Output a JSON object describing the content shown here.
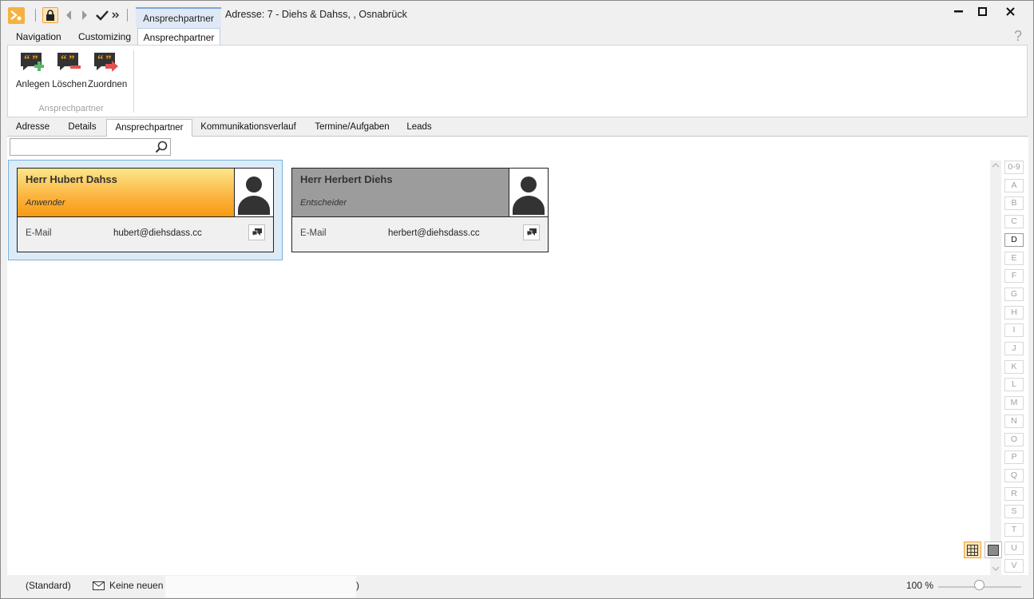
{
  "window": {
    "quick_tab_label": "Ansprechpartner",
    "title": "Adresse: 7 - Diehs & Dahss, , Osnabrück",
    "controls": {
      "minimize": "▬",
      "maximize": "☐",
      "close": "✕"
    }
  },
  "ribbon": {
    "tabs": [
      {
        "label": "Navigation"
      },
      {
        "label": "Customizing"
      },
      {
        "label": "Ansprechpartner",
        "active": true
      }
    ],
    "help": "?",
    "group_label": "Ansprechpartner",
    "buttons": [
      {
        "label": "Anlegen",
        "icon": "quote-add-icon"
      },
      {
        "label": "Löschen",
        "icon": "quote-delete-icon"
      },
      {
        "label": "Zuordnen",
        "icon": "quote-assign-icon"
      }
    ]
  },
  "content_tabs": [
    {
      "label": "Adresse"
    },
    {
      "label": "Details"
    },
    {
      "label": "Ansprechpartner",
      "active": true
    },
    {
      "label": "Kommunikationsverlauf"
    },
    {
      "label": "Termine/Aufgaben"
    },
    {
      "label": "Leads"
    }
  ],
  "search": {
    "value": "",
    "placeholder": ""
  },
  "contacts": [
    {
      "name": "Herr Hubert Dahss",
      "role": "Anwender",
      "field_label": "E-Mail",
      "field_value": "hubert@diehsdass.cc",
      "selected": true
    },
    {
      "name": "Herr Herbert Diehs",
      "role": "Entscheider",
      "field_label": "E-Mail",
      "field_value": "herbert@diehsdass.cc",
      "selected": false
    }
  ],
  "alphabet": [
    "0-9",
    "A",
    "B",
    "C",
    "D",
    "E",
    "F",
    "G",
    "H",
    "I",
    "J",
    "K",
    "L",
    "M",
    "N",
    "O",
    "P",
    "Q",
    "R",
    "S",
    "T",
    "U",
    "V"
  ],
  "alphabet_active": "D",
  "statusbar": {
    "profile": "(Standard)",
    "messages": "Keine neuen",
    "tail": ")",
    "zoom": "100 %",
    "zoom_level": 0.5
  },
  "colors": {
    "selected_card": "#fbb33d",
    "unselected_card": "#9c9c9c",
    "accent": "#f0a336"
  }
}
